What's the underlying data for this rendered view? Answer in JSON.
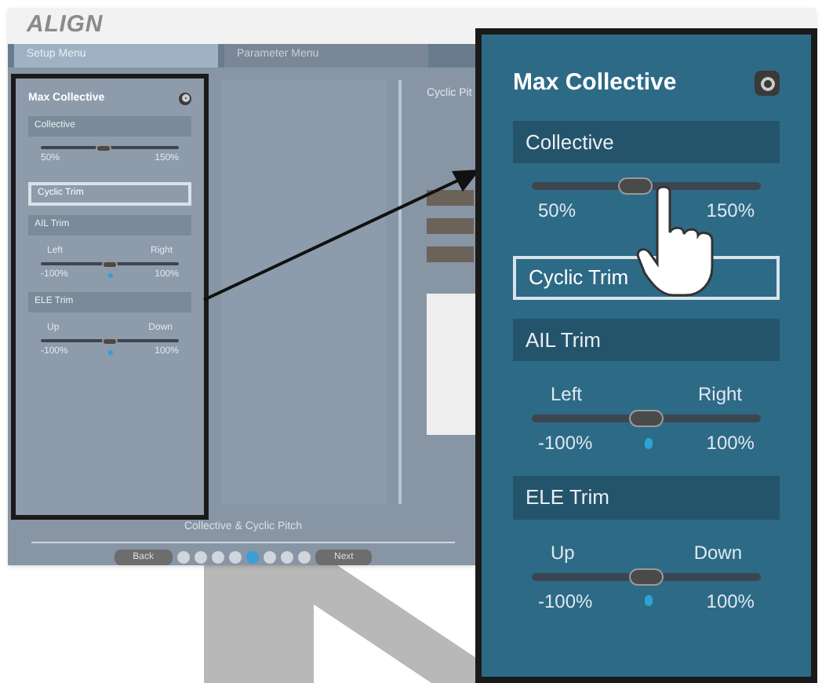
{
  "window": {
    "logo": "ALIGN"
  },
  "tabs": [
    {
      "label": "Setup Menu",
      "selected": true
    },
    {
      "label": "Parameter Menu",
      "selected": false
    }
  ],
  "left_panel": {
    "title": "Max Collective",
    "items": [
      {
        "kind": "header",
        "label": "Collective"
      },
      {
        "kind": "slider",
        "level": 0.45,
        "min": "50%",
        "max": "150%"
      },
      {
        "kind": "outlined",
        "label": "Cyclic Trim"
      },
      {
        "kind": "header",
        "label": "AIL Trim"
      },
      {
        "kind": "slider",
        "level": 0.5,
        "left": "Left",
        "right": "Right",
        "min": "-100%",
        "max": "100%"
      },
      {
        "kind": "header",
        "label": "ELE Trim"
      },
      {
        "kind": "slider",
        "level": 0.5,
        "left": "Up",
        "right": "Down",
        "min": "-100%",
        "max": "100%"
      }
    ]
  },
  "right_panel": {
    "title": "Cyclic Pit"
  },
  "footer": {
    "title": "Collective & Cyclic Pitch",
    "back": "Back",
    "next": "Next",
    "pages": [
      {
        "selected": false
      },
      {
        "selected": false
      },
      {
        "selected": false
      },
      {
        "selected": false
      },
      {
        "selected": true
      },
      {
        "selected": false
      },
      {
        "selected": false
      },
      {
        "selected": false
      }
    ]
  },
  "callout": {
    "title": "Max Collective",
    "items": [
      {
        "kind": "header",
        "label": "Collective"
      },
      {
        "kind": "slider",
        "level": 0.45,
        "min": "50%",
        "max": "150%"
      },
      {
        "kind": "outlined",
        "label": "Cyclic Trim"
      },
      {
        "kind": "header",
        "label": "AIL Trim"
      },
      {
        "kind": "slider",
        "level": 0.5,
        "left": "Left",
        "right": "Right",
        "min": "-100%",
        "max": "100%"
      },
      {
        "kind": "header",
        "label": "ELE Trim"
      },
      {
        "kind": "slider",
        "level": 0.5,
        "left": "Up",
        "right": "Down",
        "min": "-100%",
        "max": "100%"
      }
    ]
  }
}
